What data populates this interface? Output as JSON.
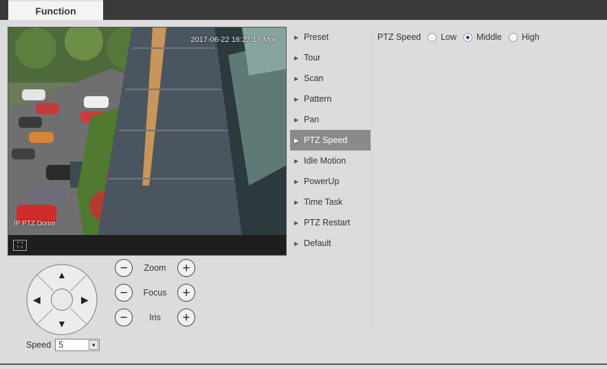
{
  "tabs": {
    "function_label": "Function"
  },
  "video": {
    "timestamp": "2017-06-22 16:27:18 Mon",
    "camera_name": "IP PTZ Dome",
    "fullscreen_glyph": "⛶"
  },
  "menu": {
    "items": [
      {
        "label": "Preset",
        "active": false
      },
      {
        "label": "Tour",
        "active": false
      },
      {
        "label": "Scan",
        "active": false
      },
      {
        "label": "Pattern",
        "active": false
      },
      {
        "label": "Pan",
        "active": false
      },
      {
        "label": "PTZ Speed",
        "active": true
      },
      {
        "label": "Idle Motion",
        "active": false
      },
      {
        "label": "PowerUp",
        "active": false
      },
      {
        "label": "Time Task",
        "active": false
      },
      {
        "label": "PTZ Restart",
        "active": false
      },
      {
        "label": "Default",
        "active": false
      }
    ]
  },
  "ptz_speed": {
    "label": "PTZ Speed",
    "options": [
      "Low",
      "Middle",
      "High"
    ],
    "selected": "Middle"
  },
  "controls": {
    "zoom_label": "Zoom",
    "focus_label": "Focus",
    "iris_label": "Iris"
  },
  "speed": {
    "label": "Speed",
    "value": "5"
  },
  "colors": {
    "topbar": "#3a3a3a",
    "active_menu": "#8a8a8a",
    "background": "#dcdcdc"
  }
}
